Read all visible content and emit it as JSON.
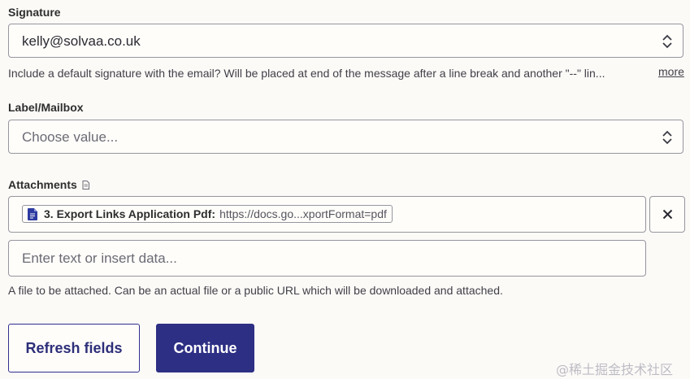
{
  "signature": {
    "label": "Signature",
    "value": "kelly@solvaa.co.uk",
    "help": "Include a default signature with the email? Will be placed at end of the message after a line break and another \"--\" lin...",
    "more": "more"
  },
  "label_mailbox": {
    "label": "Label/Mailbox",
    "placeholder": "Choose value..."
  },
  "attachments": {
    "label": "Attachments",
    "pill_title": "3. Export Links Application Pdf:",
    "pill_url": "https://docs.go...xportFormat=pdf",
    "input_placeholder": "Enter text or insert data...",
    "help": "A file to be attached. Can be an actual file or a public URL which will be downloaded and attached."
  },
  "buttons": {
    "refresh": "Refresh fields",
    "continue": "Continue"
  },
  "watermark": "@稀土掘金技术社区",
  "colors": {
    "primary": "#2d2f84",
    "border": "#96959f",
    "background": "#fcfaf7"
  },
  "icons": {
    "select_chevron": "chevron-up-down-icon",
    "file": "document-icon",
    "clear": "close-icon",
    "attachment_hint": "file-icon"
  }
}
